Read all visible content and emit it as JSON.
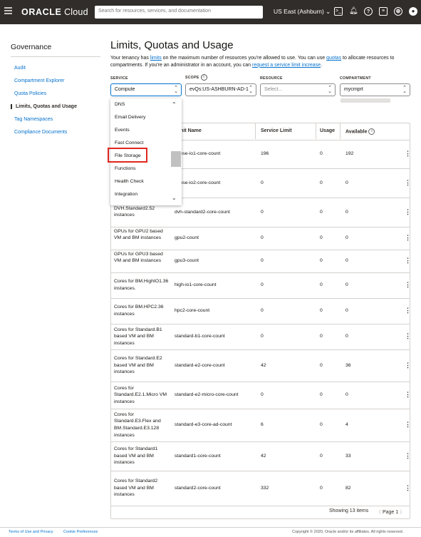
{
  "header": {
    "logo_brand": "ORACLE",
    "logo_product": " Cloud",
    "search_placeholder": "Search for resources, services, and documentation",
    "region": "US East (Ashburn)",
    "icons": [
      "menu-icon",
      "cloud-shell-icon",
      "bell-icon",
      "help-icon",
      "chat-icon",
      "globe-icon",
      "profile-icon"
    ]
  },
  "sidebar": {
    "title": "Governance",
    "items": [
      {
        "label": "Audit",
        "active": false
      },
      {
        "label": "Compartment Explorer",
        "active": false
      },
      {
        "label": "Quota Policies",
        "active": false
      },
      {
        "label": "Limits, Quotas and Usage",
        "active": true
      },
      {
        "label": "Tag Namespaces",
        "active": false
      },
      {
        "label": "Compliance Documents",
        "active": false
      }
    ]
  },
  "main": {
    "title": "Limits, Quotas and Usage",
    "desc_1": "Your tenancy has ",
    "desc_link_limits": "limits",
    "desc_2": " on the maximum number of resources you're allowed to use. You can use ",
    "desc_link_quotas": "quotas",
    "desc_3": " to allocate resources to compartments. If you're an administrator in an account, you can ",
    "desc_link_request": "request a service limit increase",
    "desc_4": "."
  },
  "filters": {
    "service_label": "SERVICE",
    "service_value": "Compute",
    "scope_label": "SCOPE",
    "scope_value": "evQs:US-ASHBURN-AD-1",
    "resource_label": "RESOURCE",
    "resource_placeholder": "Select...",
    "compartment_label": "COMPARTMENT",
    "compartment_value": "mycmprt"
  },
  "dropdown": {
    "options": [
      "DNS",
      "Email Delivery",
      "Events",
      "Fast Connect",
      "File Storage",
      "Functions",
      "Health Check",
      "Integration"
    ],
    "highlighted": "File Storage"
  },
  "table": {
    "columns": [
      "Limit Name",
      "Service Limit",
      "Usage",
      "Available"
    ],
    "rows": [
      {
        "desc": "",
        "name": "dense-io1-core-count",
        "limit": "196",
        "usage": "0",
        "available": "192"
      },
      {
        "desc": "",
        "name": "dense-io2-core-count",
        "limit": "0",
        "usage": "0",
        "available": "0"
      },
      {
        "desc": "DVH.Standard2.52 instances",
        "name": "dvh-standard2-core-count",
        "limit": "0",
        "usage": "0",
        "available": "0"
      },
      {
        "desc": "GPUs for GPU2 based VM and BM instances",
        "name": "gpu2-count",
        "limit": "0",
        "usage": "0",
        "available": "0"
      },
      {
        "desc": "GPUs for GPU3 based VM and BM instances",
        "name": "gpu3-count",
        "limit": "0",
        "usage": "0",
        "available": "0"
      },
      {
        "desc": "Cores for BM.HighIO1.36 instances.",
        "name": "high-io1-core-count",
        "limit": "0",
        "usage": "0",
        "available": "0"
      },
      {
        "desc": "Cores for BM.HPC2.36 instances",
        "name": "hpc2-core-count",
        "limit": "0",
        "usage": "0",
        "available": "0"
      },
      {
        "desc": "Cores for Standard.B1 based VM and BM instances",
        "name": "standard-b1-core-count",
        "limit": "0",
        "usage": "0",
        "available": "0"
      },
      {
        "desc": "Cores for Standard.E2 based VM and BM instances",
        "name": "standard-e2-core-count",
        "limit": "42",
        "usage": "0",
        "available": "36"
      },
      {
        "desc": "Cores for Standard.E2.1.Micro VM instances",
        "name": "standard-e2-micro-core-count",
        "limit": "0",
        "usage": "0",
        "available": "0"
      },
      {
        "desc": "Cores for Standard.E3.Flex and BM.Standard.E3.128 instances",
        "name": "standard-e3-core-ad-count",
        "limit": "6",
        "usage": "0",
        "available": "4"
      },
      {
        "desc": "Cores for Standard1 based VM and BM instances",
        "name": "standard1-core-count",
        "limit": "42",
        "usage": "0",
        "available": "33"
      },
      {
        "desc": "Cores for Standard2 based VM and BM instances",
        "name": "standard2-core-count",
        "limit": "332",
        "usage": "0",
        "available": "82"
      }
    ],
    "showing": "Showing 13 items",
    "page": "Page 1"
  },
  "footer": {
    "terms": "Terms of Use and Privacy",
    "cookies": "Cookie Preferences",
    "copyright": "Copyright © 2020, Oracle and/or its affiliates. All rights reserved."
  }
}
